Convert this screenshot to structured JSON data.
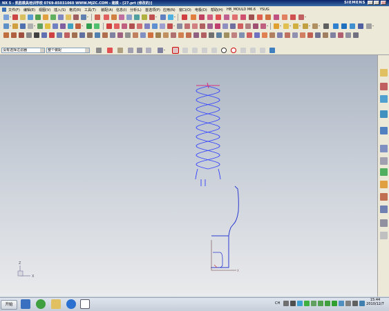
{
  "window": {
    "title": "NX 5 - 凯胜模具培训学校  0769-85031060  WWW.MJZC.COM - 建模 - [27.prt (修改的)]",
    "brand": "SIEMENS"
  },
  "menu": [
    "文件(F)",
    "编辑(E)",
    "视图(V)",
    "插入(S)",
    "格式(R)",
    "工具(T)",
    "装配(A)",
    "信息(I)",
    "分析(L)",
    "首选项(P)",
    "应用(N)",
    "窗口(O)",
    "电极(D)",
    "帮助(H)",
    "HB_MOULD M6.6",
    "YSUG"
  ],
  "selection_bar": {
    "filter_value": "没有选择过滤器",
    "scope_value": "整个装配"
  },
  "viewport": {
    "triad_labels": {
      "x": "X",
      "y": "Y",
      "z": "Z"
    },
    "colors": {
      "helix": "#3040ff",
      "curve": "#2a3ad0",
      "top_mark": "#d83080"
    }
  },
  "taskbar": {
    "start_label": "开始",
    "ime_label": "CH",
    "clock_time": "15:44",
    "clock_date": "2010/12/7"
  }
}
